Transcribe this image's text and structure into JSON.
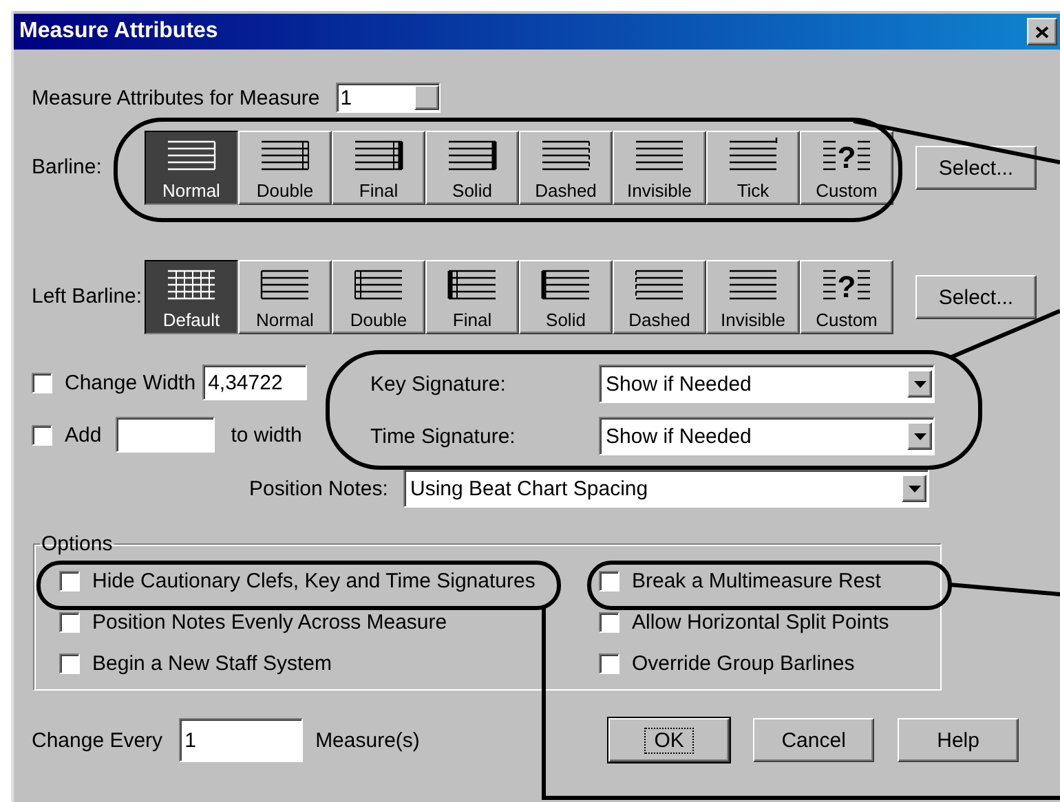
{
  "window": {
    "title": "Measure Attributes"
  },
  "measure": {
    "label": "Measure Attributes for Measure",
    "value": "1"
  },
  "barline": {
    "label": "Barline:",
    "select_button": "Select...",
    "options": [
      {
        "kind": "normal",
        "label": "Normal",
        "selected": true
      },
      {
        "kind": "double",
        "label": "Double",
        "selected": false
      },
      {
        "kind": "final",
        "label": "Final",
        "selected": false
      },
      {
        "kind": "solid",
        "label": "Solid",
        "selected": false
      },
      {
        "kind": "dashed",
        "label": "Dashed",
        "selected": false
      },
      {
        "kind": "invisible",
        "label": "Invisible",
        "selected": false
      },
      {
        "kind": "tick",
        "label": "Tick",
        "selected": false
      },
      {
        "kind": "custom",
        "label": "Custom",
        "glyph": "?",
        "selected": false
      }
    ]
  },
  "left_barline": {
    "label": "Left Barline:",
    "select_button": "Select...",
    "options": [
      {
        "kind": "default",
        "label": "Default",
        "selected": true
      },
      {
        "kind": "normal",
        "label": "Normal",
        "selected": false
      },
      {
        "kind": "double",
        "label": "Double",
        "selected": false
      },
      {
        "kind": "final",
        "label": "Final",
        "selected": false
      },
      {
        "kind": "solid",
        "label": "Solid",
        "selected": false
      },
      {
        "kind": "dashed",
        "label": "Dashed",
        "selected": false
      },
      {
        "kind": "invisible",
        "label": "Invisible",
        "selected": false
      },
      {
        "kind": "custom",
        "label": "Custom",
        "glyph": "?",
        "selected": false
      }
    ]
  },
  "change_width": {
    "label": "Change Width",
    "checked": false,
    "value": "4,34722"
  },
  "add": {
    "label": "Add",
    "checked": false,
    "suffix": "to width"
  },
  "key_signature": {
    "label": "Key Signature:",
    "value": "Show if Needed"
  },
  "time_signature": {
    "label": "Time Signature:",
    "value": "Show if Needed"
  },
  "position_notes": {
    "label": "Position Notes:",
    "value": "Using Beat Chart Spacing"
  },
  "options": {
    "title": "Options",
    "left": [
      {
        "label": "Hide Cautionary Clefs, Key and Time Signatures",
        "checked": false
      },
      {
        "label": "Position Notes Evenly Across Measure",
        "checked": false
      },
      {
        "label": "Begin a New Staff System",
        "checked": false
      }
    ],
    "right": [
      {
        "label": "Break a Multimeasure Rest",
        "checked": false
      },
      {
        "label": "Allow Horizontal Split Points",
        "checked": false
      },
      {
        "label": "Override Group Barlines",
        "checked": false
      }
    ]
  },
  "change_every": {
    "label": "Change Every",
    "value": "1",
    "suffix": "Measure(s)"
  },
  "buttons": [
    {
      "label": "OK",
      "default": true
    },
    {
      "label": "Cancel",
      "default": false
    },
    {
      "label": "Help",
      "default": false
    }
  ]
}
